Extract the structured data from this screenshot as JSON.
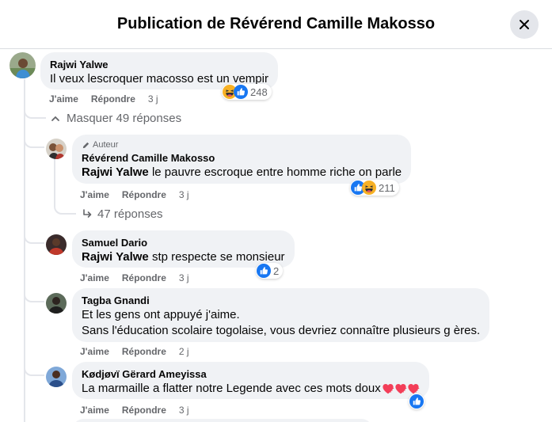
{
  "header": {
    "title": "Publication de Révérend Camille Makosso"
  },
  "colors": {
    "like_blue": "#1877f2",
    "haha_yellow": "#f7b125",
    "heart_red": "#f33e58"
  },
  "comments": [
    {
      "author": "Rajwi Yalwe",
      "text": "Il veux lescroquer macosso est un vempir",
      "actions": {
        "like": "J'aime",
        "reply": "Répondre",
        "time": "3 j"
      },
      "reactions": {
        "icons": [
          "haha-icon",
          "like-icon"
        ],
        "count": "248"
      },
      "toggle": "Masquer 49 réponses"
    },
    {
      "badge": "Auteur",
      "author": "Révérend Camille Makosso",
      "mention": "Rajwi Yalwe",
      "text": " le pauvre escroque entre homme riche on parle",
      "actions": {
        "like": "J'aime",
        "reply": "Répondre",
        "time": "3 j"
      },
      "reactions": {
        "icons": [
          "like-icon",
          "haha-icon"
        ],
        "count": "211"
      },
      "replies": "47 réponses"
    },
    {
      "author": "Samuel Dario",
      "mention": "Rajwi Yalwe",
      "text": " stp respecte se monsieur",
      "actions": {
        "like": "J'aime",
        "reply": "Répondre",
        "time": "3 j"
      },
      "reactions": {
        "icons": [
          "like-icon"
        ],
        "count": "2"
      }
    },
    {
      "author": "Tagba Gnandi",
      "text_lines": [
        "Et les gens ont appuyé j'aime.",
        "Sans l'éducation scolaire togolaise, vous devriez connaître plusieurs g ères."
      ],
      "actions": {
        "like": "J'aime",
        "reply": "Répondre",
        "time": "2 j"
      }
    },
    {
      "author": "Kødjøvï Gërard Ameyissa",
      "text": "La marmaille a flatter notre Legende avec ces mots doux",
      "emoji": [
        "heart-emoji",
        "heart-emoji",
        "heart-emoji"
      ],
      "actions": {
        "like": "J'aime",
        "reply": "Répondre",
        "time": "3 j"
      },
      "reactions": {
        "icons": [
          "like-icon"
        ],
        "count": ""
      }
    }
  ]
}
